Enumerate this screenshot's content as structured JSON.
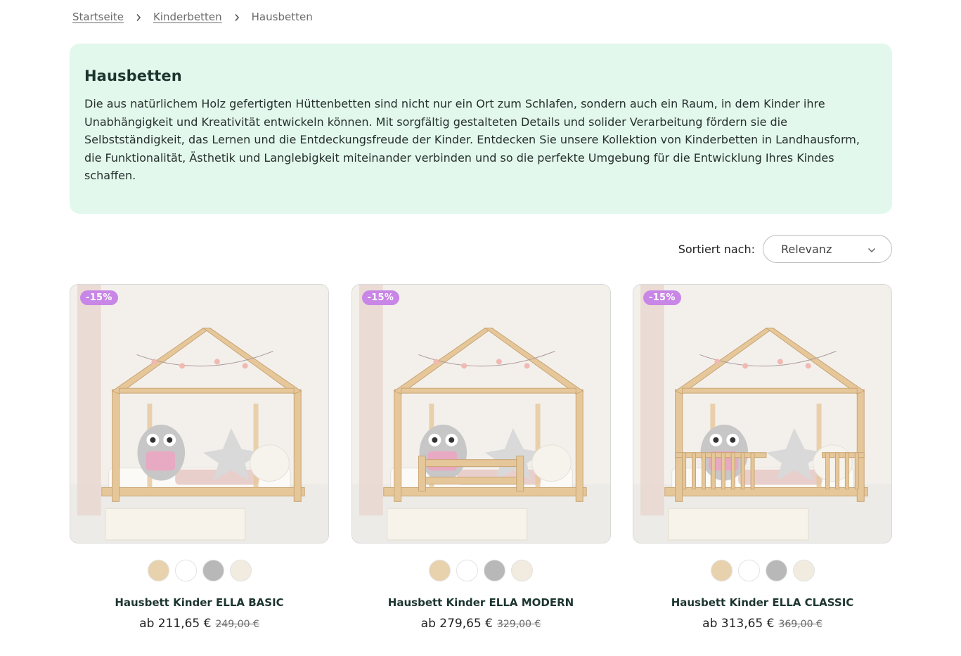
{
  "breadcrumb": {
    "items": [
      {
        "label": "Startseite"
      },
      {
        "label": "Kinderbetten"
      }
    ],
    "current": "Hausbetten"
  },
  "intro": {
    "title": "Hausbetten",
    "text": "Die aus natürlichem Holz gefertigten Hüttenbetten sind nicht nur ein Ort zum Schlafen, sondern auch ein Raum, in dem Kinder ihre Unabhängigkeit und Kreativität entwickeln können. Mit sorgfältig gestalteten Details und solider Verarbeitung fördern sie die Selbstständigkeit, das Lernen und die Entdeckungsfreude der Kinder. Entdecken Sie unsere Kollektion von Kinderbetten in Landhausform, die Funktionalität, Ästhetik und Langlebigkeit miteinander verbinden und so die perfekte Umgebung für die Entwicklung Ihres Kindes schaffen."
  },
  "sort": {
    "label": "Sortiert nach:",
    "selected": "Relevanz"
  },
  "swatch_colors": [
    "#e8d2ad",
    "#ffffff",
    "#b8b8b8",
    "#f1ebe0"
  ],
  "products": [
    {
      "badge": "-15%",
      "title": "Hausbett Kinder ELLA BASIC",
      "price": "ab 211,65 €",
      "old_price": "249,00 €",
      "variant": "basic"
    },
    {
      "badge": "-15%",
      "title": "Hausbett Kinder ELLA MODERN",
      "price": "ab 279,65 €",
      "old_price": "329,00 €",
      "variant": "modern"
    },
    {
      "badge": "-15%",
      "title": "Hausbett Kinder ELLA CLASSIC",
      "price": "ab 313,65 €",
      "old_price": "369,00 €",
      "variant": "classic"
    }
  ]
}
